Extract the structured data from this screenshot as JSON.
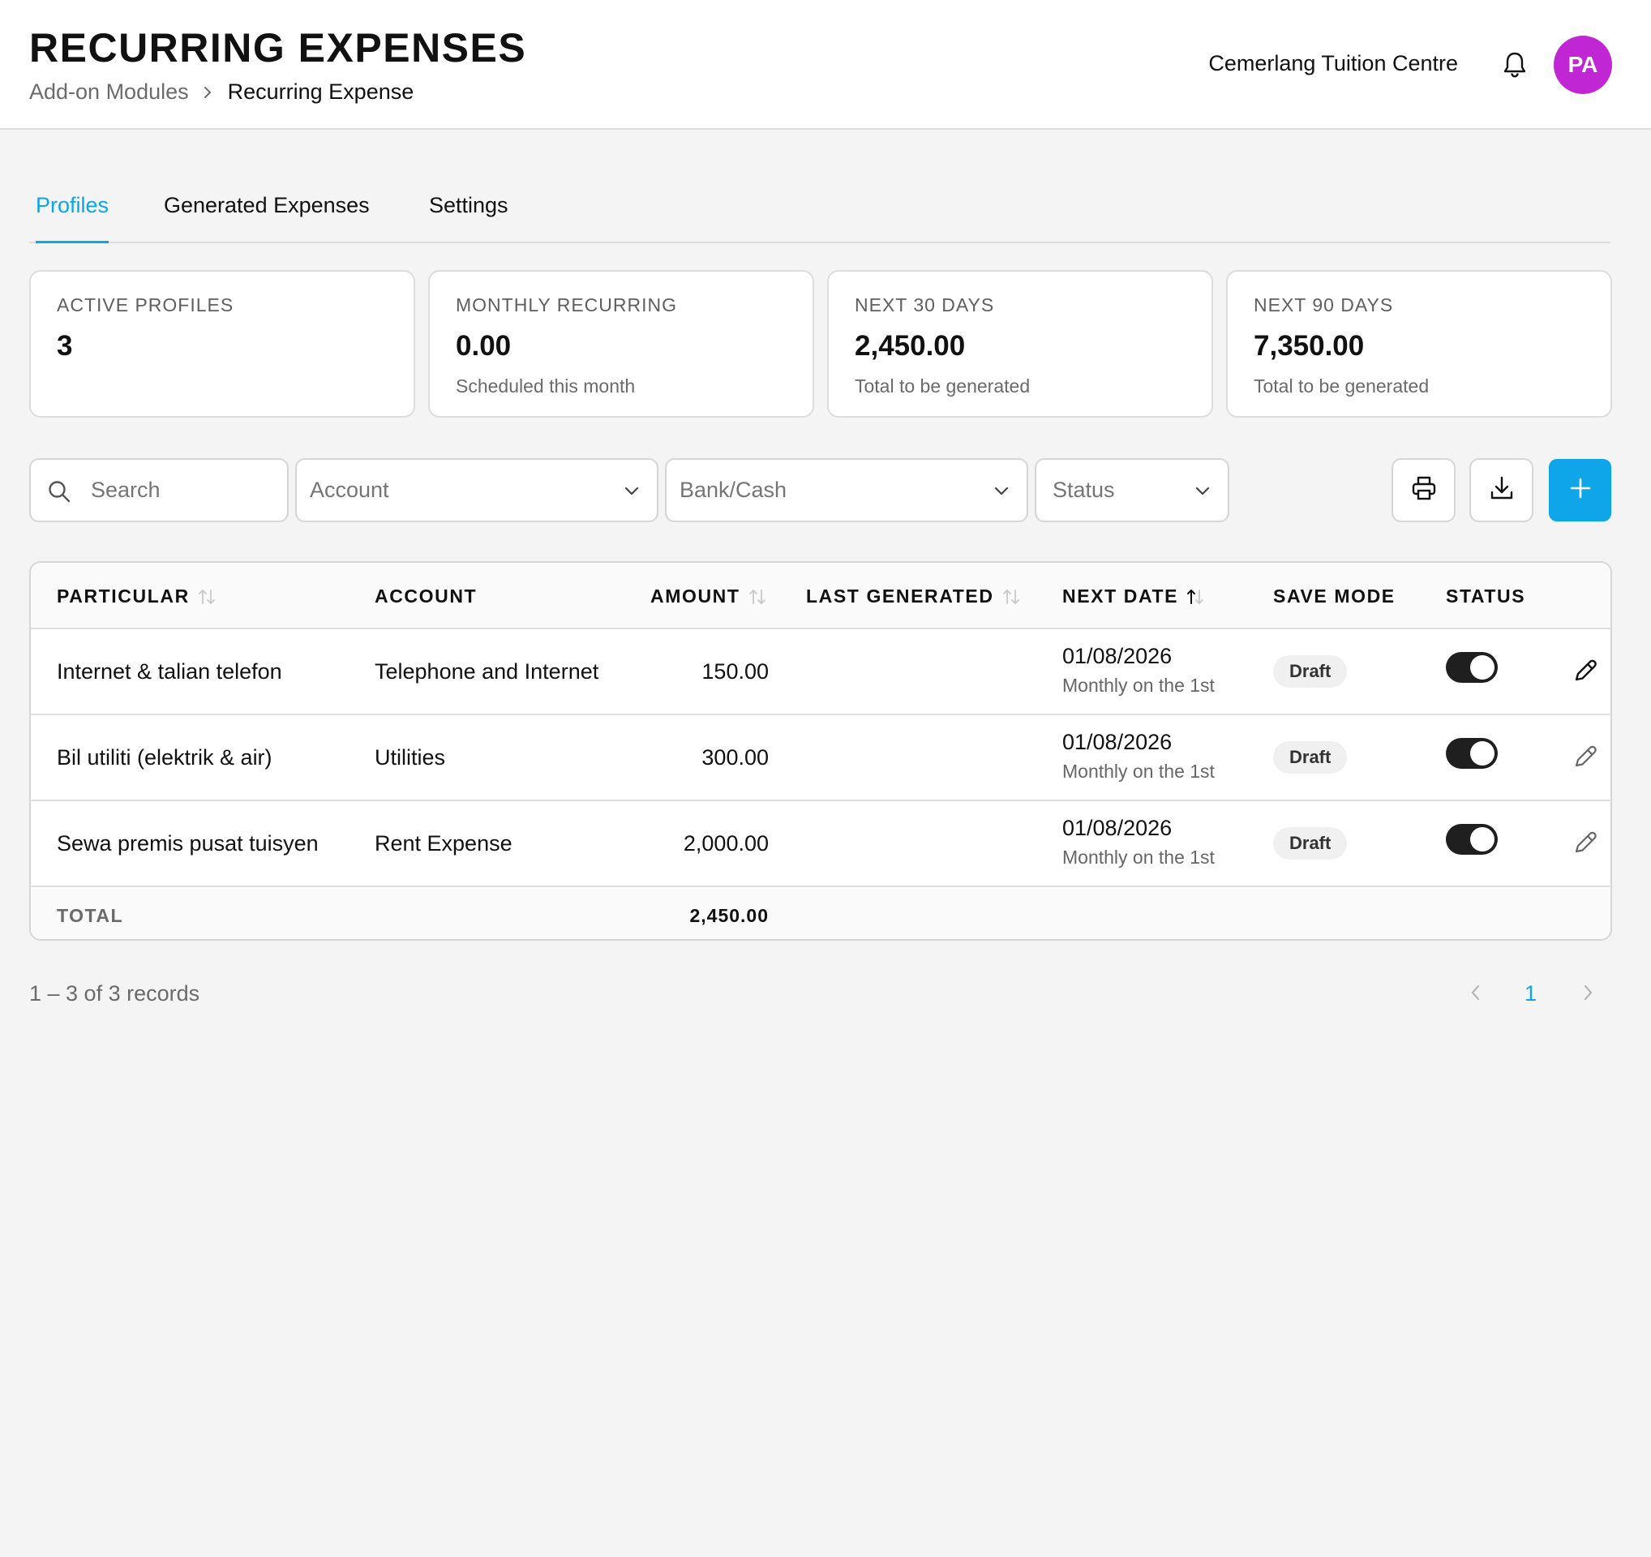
{
  "header": {
    "title": "RECURRING EXPENSES",
    "breadcrumb": {
      "parent": "Add-on Modules",
      "current": "Recurring Expense"
    },
    "company": "Cemerlang Tuition Centre",
    "avatar_initials": "PA",
    "avatar_color": "#c026d3"
  },
  "tabs": [
    {
      "label": "Profiles",
      "active": true
    },
    {
      "label": "Generated Expenses",
      "active": false
    },
    {
      "label": "Settings",
      "active": false
    }
  ],
  "stats": [
    {
      "label": "ACTIVE PROFILES",
      "value": "3",
      "sub": ""
    },
    {
      "label": "MONTHLY RECURRING",
      "value": "0.00",
      "sub": "Scheduled this month"
    },
    {
      "label": "NEXT 30 DAYS",
      "value": "2,450.00",
      "sub": "Total to be generated"
    },
    {
      "label": "NEXT 90 DAYS",
      "value": "7,350.00",
      "sub": "Total to be generated"
    }
  ],
  "filters": {
    "search_placeholder": "Search",
    "account_placeholder": "Account",
    "bank_placeholder": "Bank/Cash",
    "status_placeholder": "Status"
  },
  "actions": {
    "print_icon": "printer-icon",
    "download_icon": "download-icon",
    "add_icon": "plus-icon",
    "accent_color": "#0ea5e9"
  },
  "table": {
    "columns": {
      "particular": "PARTICULAR",
      "account": "ACCOUNT",
      "amount": "AMOUNT",
      "last_generated": "LAST GENERATED",
      "next_date": "NEXT DATE",
      "save_mode": "SAVE MODE",
      "status": "STATUS"
    },
    "rows": [
      {
        "particular": "Internet & talian telefon",
        "account": "Telephone and Internet",
        "amount": "150.00",
        "last_generated": "",
        "next_date": "01/08/2026",
        "frequency": "Monthly on the 1st",
        "save_mode": "Draft",
        "status_on": true
      },
      {
        "particular": "Bil utiliti (elektrik & air)",
        "account": "Utilities",
        "amount": "300.00",
        "last_generated": "",
        "next_date": "01/08/2026",
        "frequency": "Monthly on the 1st",
        "save_mode": "Draft",
        "status_on": true
      },
      {
        "particular": "Sewa premis pusat tuisyen",
        "account": "Rent Expense",
        "amount": "2,000.00",
        "last_generated": "",
        "next_date": "01/08/2026",
        "frequency": "Monthly on the 1st",
        "save_mode": "Draft",
        "status_on": true
      }
    ],
    "total_label": "TOTAL",
    "total_amount": "2,450.00"
  },
  "pagination": {
    "summary": "1 – 3 of 3 records",
    "current_page": "1"
  }
}
